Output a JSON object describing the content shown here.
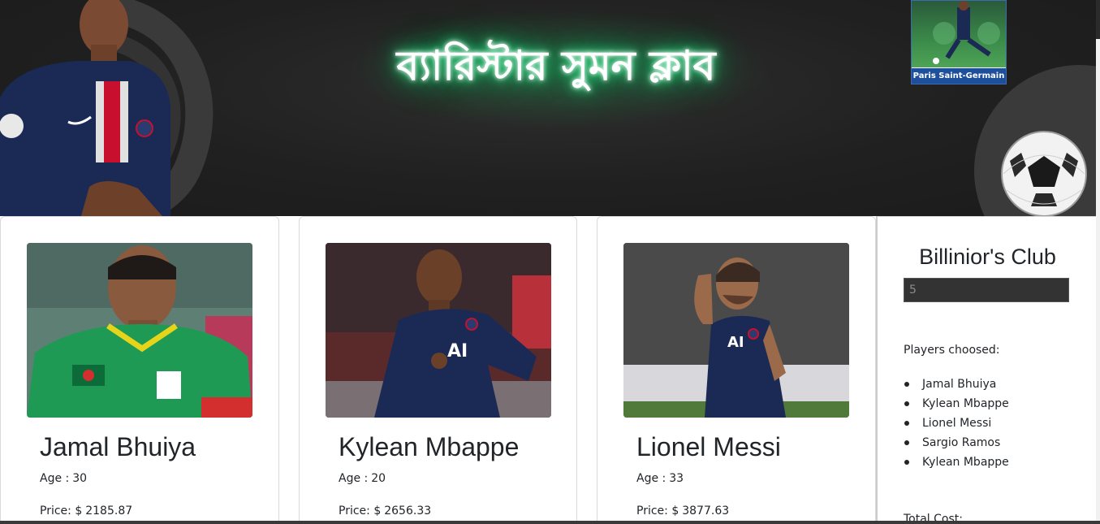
{
  "banner": {
    "title": "ব্যারিস্টার সুমন ক্লাব",
    "psg_caption": "Paris Saint-Germain"
  },
  "labels": {
    "age": "Age :",
    "price": "Price: $"
  },
  "players": [
    {
      "name": "Jamal Bhuiya",
      "age": "30",
      "price": "2185.87"
    },
    {
      "name": "Kylean Mbappe",
      "age": "20",
      "price": "2656.33"
    },
    {
      "name": "Lionel Messi",
      "age": "33",
      "price": "3877.63"
    }
  ],
  "club": {
    "title": "Billinior's Club",
    "input_placeholder": "5",
    "players_label": "Players choosed:",
    "chosen": [
      "Jamal Bhuiya",
      "Kylean Mbappe",
      "Lionel Messi",
      "Sargio Ramos",
      "Kylean Mbappe"
    ],
    "total_label": "Total Cost:"
  },
  "colors": {
    "neon_glow": "#18c46b",
    "banner_bg": "#202020",
    "psg_navy": "#1b2a55"
  }
}
